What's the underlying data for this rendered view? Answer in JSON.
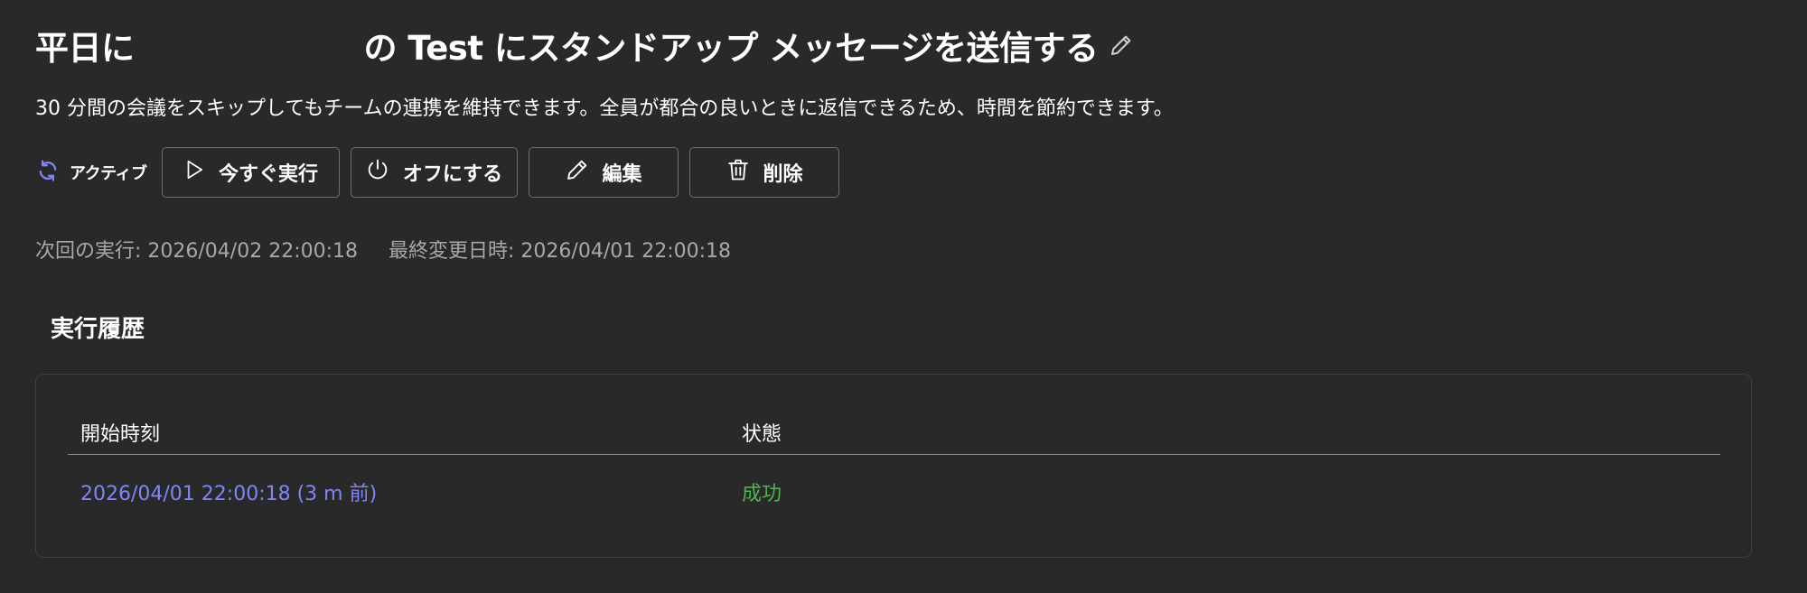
{
  "header": {
    "title_prefix": "平日に",
    "title_suffix": "の Test にスタンドアップ メッセージを送信する",
    "description": "30 分間の会議をスキップしてもチームの連携を維持できます。全員が都合の良いときに返信できるため、時間を節約できます。"
  },
  "status": {
    "label": "アクティブ",
    "icon": "sync-icon",
    "color": "#7f85f5"
  },
  "actions": {
    "run_now": "今すぐ実行",
    "turn_off": "オフにする",
    "edit": "編集",
    "delete": "削除"
  },
  "meta": {
    "next_run": "次回の実行: 2026/04/02 22:00:18",
    "last_modified": "最終変更日時: 2026/04/01 22:00:18"
  },
  "history": {
    "section_title": "実行履歴",
    "columns": [
      "開始時刻",
      "状態"
    ],
    "rows": [
      {
        "start_time": "2026/04/01 22:00:18 (3 m 前)",
        "status": "成功"
      }
    ]
  },
  "colors": {
    "background": "#292929",
    "link": "#7f85f5",
    "success": "#54b054",
    "muted": "#a8a8a8"
  }
}
